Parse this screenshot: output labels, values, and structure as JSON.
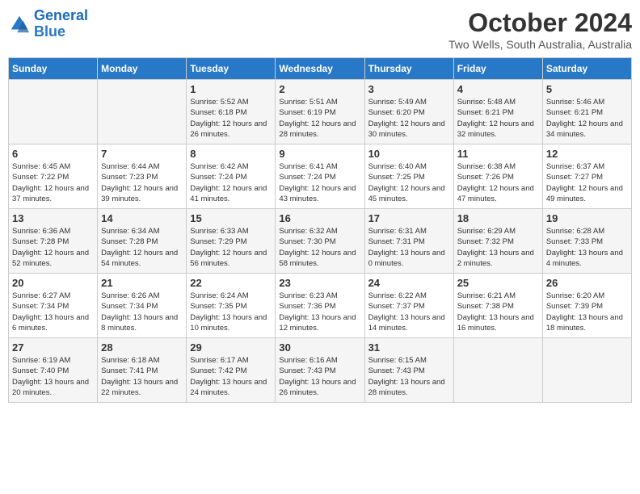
{
  "logo": {
    "line1": "General",
    "line2": "Blue"
  },
  "title": "October 2024",
  "location": "Two Wells, South Australia, Australia",
  "headers": [
    "Sunday",
    "Monday",
    "Tuesday",
    "Wednesday",
    "Thursday",
    "Friday",
    "Saturday"
  ],
  "weeks": [
    [
      {
        "day": "",
        "sunrise": "",
        "sunset": "",
        "daylight": ""
      },
      {
        "day": "",
        "sunrise": "",
        "sunset": "",
        "daylight": ""
      },
      {
        "day": "1",
        "sunrise": "Sunrise: 5:52 AM",
        "sunset": "Sunset: 6:18 PM",
        "daylight": "Daylight: 12 hours and 26 minutes."
      },
      {
        "day": "2",
        "sunrise": "Sunrise: 5:51 AM",
        "sunset": "Sunset: 6:19 PM",
        "daylight": "Daylight: 12 hours and 28 minutes."
      },
      {
        "day": "3",
        "sunrise": "Sunrise: 5:49 AM",
        "sunset": "Sunset: 6:20 PM",
        "daylight": "Daylight: 12 hours and 30 minutes."
      },
      {
        "day": "4",
        "sunrise": "Sunrise: 5:48 AM",
        "sunset": "Sunset: 6:21 PM",
        "daylight": "Daylight: 12 hours and 32 minutes."
      },
      {
        "day": "5",
        "sunrise": "Sunrise: 5:46 AM",
        "sunset": "Sunset: 6:21 PM",
        "daylight": "Daylight: 12 hours and 34 minutes."
      }
    ],
    [
      {
        "day": "6",
        "sunrise": "Sunrise: 6:45 AM",
        "sunset": "Sunset: 7:22 PM",
        "daylight": "Daylight: 12 hours and 37 minutes."
      },
      {
        "day": "7",
        "sunrise": "Sunrise: 6:44 AM",
        "sunset": "Sunset: 7:23 PM",
        "daylight": "Daylight: 12 hours and 39 minutes."
      },
      {
        "day": "8",
        "sunrise": "Sunrise: 6:42 AM",
        "sunset": "Sunset: 7:24 PM",
        "daylight": "Daylight: 12 hours and 41 minutes."
      },
      {
        "day": "9",
        "sunrise": "Sunrise: 6:41 AM",
        "sunset": "Sunset: 7:24 PM",
        "daylight": "Daylight: 12 hours and 43 minutes."
      },
      {
        "day": "10",
        "sunrise": "Sunrise: 6:40 AM",
        "sunset": "Sunset: 7:25 PM",
        "daylight": "Daylight: 12 hours and 45 minutes."
      },
      {
        "day": "11",
        "sunrise": "Sunrise: 6:38 AM",
        "sunset": "Sunset: 7:26 PM",
        "daylight": "Daylight: 12 hours and 47 minutes."
      },
      {
        "day": "12",
        "sunrise": "Sunrise: 6:37 AM",
        "sunset": "Sunset: 7:27 PM",
        "daylight": "Daylight: 12 hours and 49 minutes."
      }
    ],
    [
      {
        "day": "13",
        "sunrise": "Sunrise: 6:36 AM",
        "sunset": "Sunset: 7:28 PM",
        "daylight": "Daylight: 12 hours and 52 minutes."
      },
      {
        "day": "14",
        "sunrise": "Sunrise: 6:34 AM",
        "sunset": "Sunset: 7:28 PM",
        "daylight": "Daylight: 12 hours and 54 minutes."
      },
      {
        "day": "15",
        "sunrise": "Sunrise: 6:33 AM",
        "sunset": "Sunset: 7:29 PM",
        "daylight": "Daylight: 12 hours and 56 minutes."
      },
      {
        "day": "16",
        "sunrise": "Sunrise: 6:32 AM",
        "sunset": "Sunset: 7:30 PM",
        "daylight": "Daylight: 12 hours and 58 minutes."
      },
      {
        "day": "17",
        "sunrise": "Sunrise: 6:31 AM",
        "sunset": "Sunset: 7:31 PM",
        "daylight": "Daylight: 13 hours and 0 minutes."
      },
      {
        "day": "18",
        "sunrise": "Sunrise: 6:29 AM",
        "sunset": "Sunset: 7:32 PM",
        "daylight": "Daylight: 13 hours and 2 minutes."
      },
      {
        "day": "19",
        "sunrise": "Sunrise: 6:28 AM",
        "sunset": "Sunset: 7:33 PM",
        "daylight": "Daylight: 13 hours and 4 minutes."
      }
    ],
    [
      {
        "day": "20",
        "sunrise": "Sunrise: 6:27 AM",
        "sunset": "Sunset: 7:34 PM",
        "daylight": "Daylight: 13 hours and 6 minutes."
      },
      {
        "day": "21",
        "sunrise": "Sunrise: 6:26 AM",
        "sunset": "Sunset: 7:34 PM",
        "daylight": "Daylight: 13 hours and 8 minutes."
      },
      {
        "day": "22",
        "sunrise": "Sunrise: 6:24 AM",
        "sunset": "Sunset: 7:35 PM",
        "daylight": "Daylight: 13 hours and 10 minutes."
      },
      {
        "day": "23",
        "sunrise": "Sunrise: 6:23 AM",
        "sunset": "Sunset: 7:36 PM",
        "daylight": "Daylight: 13 hours and 12 minutes."
      },
      {
        "day": "24",
        "sunrise": "Sunrise: 6:22 AM",
        "sunset": "Sunset: 7:37 PM",
        "daylight": "Daylight: 13 hours and 14 minutes."
      },
      {
        "day": "25",
        "sunrise": "Sunrise: 6:21 AM",
        "sunset": "Sunset: 7:38 PM",
        "daylight": "Daylight: 13 hours and 16 minutes."
      },
      {
        "day": "26",
        "sunrise": "Sunrise: 6:20 AM",
        "sunset": "Sunset: 7:39 PM",
        "daylight": "Daylight: 13 hours and 18 minutes."
      }
    ],
    [
      {
        "day": "27",
        "sunrise": "Sunrise: 6:19 AM",
        "sunset": "Sunset: 7:40 PM",
        "daylight": "Daylight: 13 hours and 20 minutes."
      },
      {
        "day": "28",
        "sunrise": "Sunrise: 6:18 AM",
        "sunset": "Sunset: 7:41 PM",
        "daylight": "Daylight: 13 hours and 22 minutes."
      },
      {
        "day": "29",
        "sunrise": "Sunrise: 6:17 AM",
        "sunset": "Sunset: 7:42 PM",
        "daylight": "Daylight: 13 hours and 24 minutes."
      },
      {
        "day": "30",
        "sunrise": "Sunrise: 6:16 AM",
        "sunset": "Sunset: 7:43 PM",
        "daylight": "Daylight: 13 hours and 26 minutes."
      },
      {
        "day": "31",
        "sunrise": "Sunrise: 6:15 AM",
        "sunset": "Sunset: 7:43 PM",
        "daylight": "Daylight: 13 hours and 28 minutes."
      },
      {
        "day": "",
        "sunrise": "",
        "sunset": "",
        "daylight": ""
      },
      {
        "day": "",
        "sunrise": "",
        "sunset": "",
        "daylight": ""
      }
    ]
  ]
}
